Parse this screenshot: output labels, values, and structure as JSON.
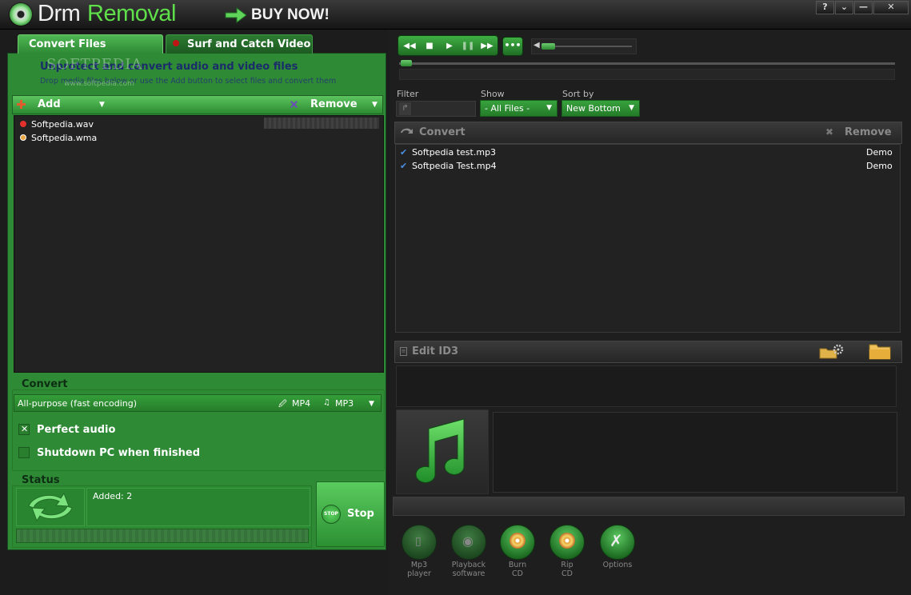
{
  "window": {
    "app_name_part1": "Drm",
    "app_name_part2": "Removal",
    "buy_now": "BUY NOW!",
    "help_btn": "?",
    "menu_btn": "⌄",
    "minimize_btn": "—",
    "close_btn": "✕"
  },
  "tabs": [
    {
      "label": "Convert Files"
    },
    {
      "label": "Surf and Catch Video"
    }
  ],
  "convert_panel": {
    "heading": "Unprotect and convert audio and video files",
    "subheading": "Drop media files below or use the Add button to select files and convert them",
    "add_label": "Add",
    "remove_label": "Remove",
    "files": [
      {
        "name": "Softpedia.wav",
        "dot_color": "#e0312c"
      },
      {
        "name": "Softpedia.wma",
        "dot_color": "#e8a640"
      }
    ],
    "convert_section_label": "Convert",
    "preset": "All-purpose (fast encoding)",
    "video_format": "MP4",
    "audio_format": "MP3",
    "perfect_audio_label": "Perfect audio",
    "perfect_audio_checked": true,
    "shutdown_label": "Shutdown PC when finished",
    "shutdown_checked": false,
    "status_label": "Status",
    "status_text": "Added: 2",
    "stop_icon_text": "STOP",
    "stop_label": "Stop"
  },
  "watermark": {
    "brand": "SOFTPEDIA",
    "url": "www.softpedia.com"
  },
  "player": {
    "buttons": [
      "rewind-icon",
      "stop-icon",
      "play-icon",
      "pause-icon",
      "fast-forward-icon"
    ],
    "more_label": "•••",
    "volume_level": 0.12,
    "seek_position": 0.0
  },
  "filters": {
    "filter_label": "Filter",
    "filter_value": "",
    "show_label": "Show",
    "show_value": "- All Files -",
    "sort_label": "Sort by",
    "sort_value": "New Bottom"
  },
  "queue": {
    "convert_label": "Convert",
    "remove_label": "Remove",
    "items": [
      {
        "name": "Softpedia test.mp3",
        "status": "Demo"
      },
      {
        "name": "Softpedia Test.mp4",
        "status": "Demo"
      }
    ]
  },
  "id3": {
    "label": "Edit ID3"
  },
  "tools": [
    {
      "line1": "Mp3",
      "line2": "player",
      "enabled": false
    },
    {
      "line1": "Playback",
      "line2": "software",
      "enabled": false
    },
    {
      "line1": "Burn",
      "line2": "CD",
      "enabled": true
    },
    {
      "line1": "Rip",
      "line2": "CD",
      "enabled": true
    },
    {
      "line1": "Options",
      "line2": "",
      "enabled": true
    }
  ],
  "colors": {
    "accent_green": "#2e8a35",
    "brand_green": "#5fe04a",
    "dark_bg": "#1e1e1e"
  }
}
